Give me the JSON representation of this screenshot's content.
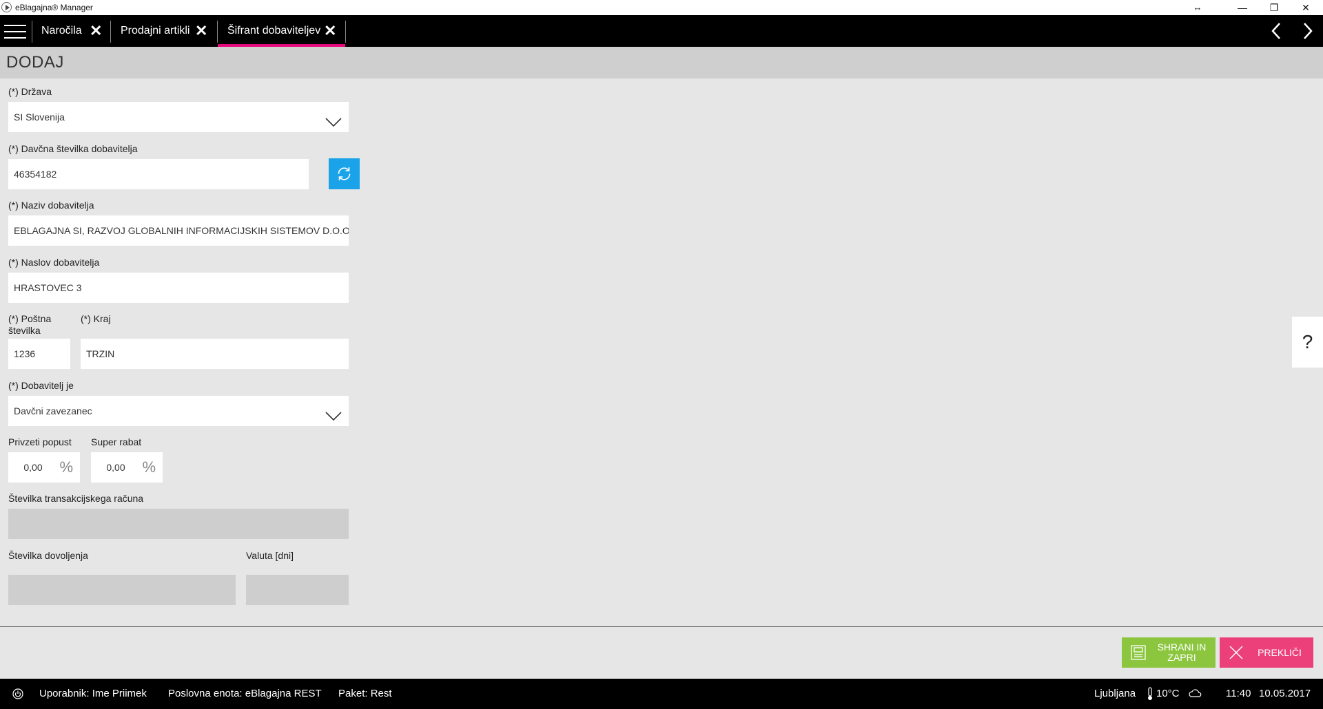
{
  "window": {
    "title": "eBlagajna® Manager",
    "resize_glyph": "↔",
    "min_glyph": "—",
    "max_glyph": "❐",
    "close_glyph": "✕"
  },
  "tabs": [
    {
      "label": "Naročila",
      "close": "✕"
    },
    {
      "label": "Prodajni artikli",
      "close": "✕"
    },
    {
      "label": "Šifrant dobaviteljev",
      "close": "✕",
      "active": true
    }
  ],
  "page": {
    "title": "DODAJ"
  },
  "form": {
    "country": {
      "label": "(*) Država",
      "value": "SI Slovenija"
    },
    "tax_number": {
      "label": "(*) Davčna številka dobavitelja",
      "value": "46354182"
    },
    "supplier_name": {
      "label": "(*) Naziv dobavitelja",
      "value": "EBLAGAJNA SI, RAZVOJ GLOBALNIH INFORMACIJSKIH SISTEMOV D.O.O."
    },
    "supplier_address": {
      "label": "(*) Naslov dobavitelja",
      "value": "HRASTOVEC 3"
    },
    "postal_code": {
      "label": "(*) Poštna številka",
      "value": "1236"
    },
    "city": {
      "label": "(*) Kraj",
      "value": "TRZIN"
    },
    "supplier_type": {
      "label": "(*) Dobavitelj je",
      "value": "Davčni zavezanec"
    },
    "default_discount": {
      "label": "Privzeti popust",
      "value": "0,00",
      "unit": "%"
    },
    "super_rebate": {
      "label": "Super rabat",
      "value": "0,00",
      "unit": "%"
    },
    "bank_account": {
      "label": "Številka transakcijskega računa",
      "value": ""
    },
    "permit_number": {
      "label": "Številka dovoljenja",
      "value": ""
    },
    "payment_term": {
      "label": "Valuta [dni]",
      "value": ""
    }
  },
  "help": {
    "label": "?"
  },
  "actions": {
    "save_label": "SHRANI IN ZAPRI",
    "cancel_label": "PREKLIČI"
  },
  "status": {
    "user": "Uporabnik: Ime Priimek",
    "business_unit": "Poslovna enota: eBlagajna REST",
    "package": "Paket: Rest",
    "city": "Ljubljana",
    "temperature": "10°C",
    "time": "11:40",
    "date": "10.05.2017"
  },
  "colors": {
    "accent": "#e4087c",
    "refresh": "#1aa3e8",
    "save": "#8cc63f",
    "cancel": "#ec407a"
  }
}
